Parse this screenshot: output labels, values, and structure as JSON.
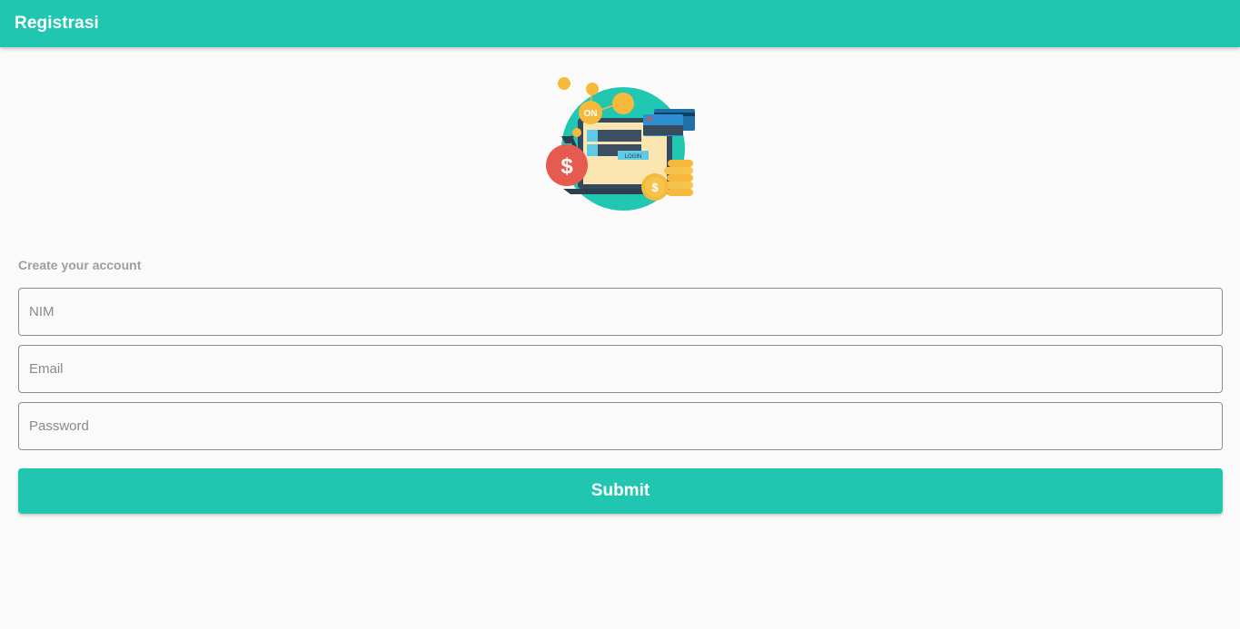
{
  "app_bar": {
    "title": "Registrasi",
    "color": "#21c6b0"
  },
  "illustration": {
    "icon": "online-payment-illustration",
    "badge_text": "ON",
    "login_text": "LOGIN",
    "currency_symbol": "$"
  },
  "form": {
    "subtitle": "Create your account",
    "fields": {
      "nim_placeholder": "NIM",
      "email_placeholder": "Email",
      "password_placeholder": "Password"
    },
    "submit_label": "Submit"
  }
}
